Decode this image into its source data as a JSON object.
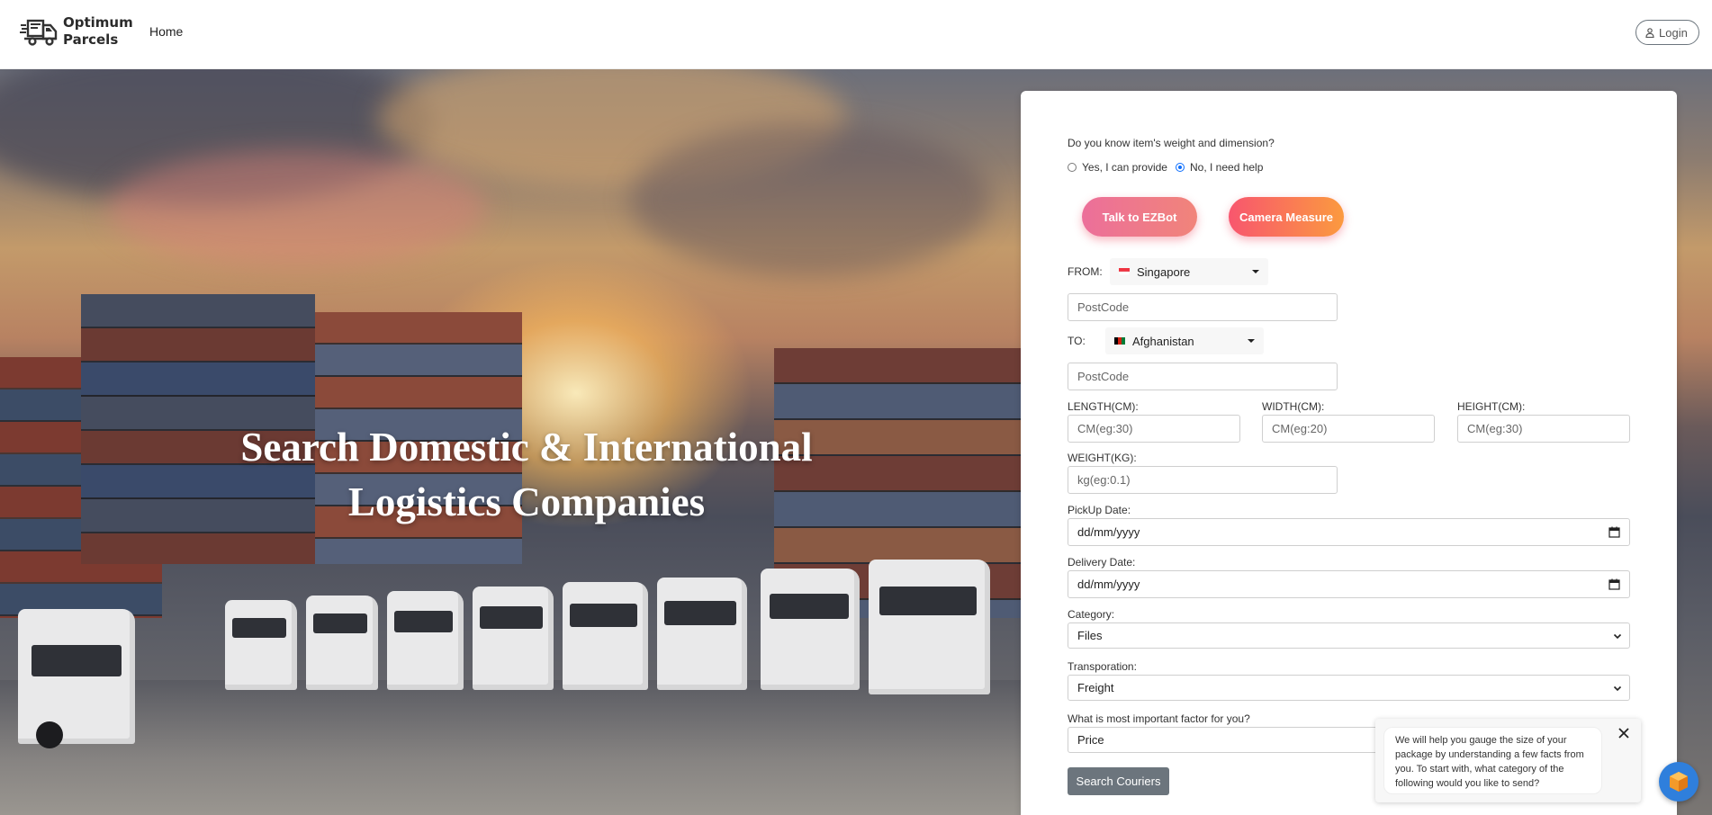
{
  "header": {
    "brand_line1": "Optimum",
    "brand_line2": "Parcels",
    "nav_home": "Home",
    "login_label": "Login"
  },
  "hero": {
    "title_line1": "Search Domestic & International",
    "title_line2": "Logistics Companies"
  },
  "form": {
    "question": "Do you know item's weight and dimension?",
    "radio_yes": "Yes, I can provide",
    "radio_no": "No, I need help",
    "radio_selected": "no",
    "ezbot_label": "Talk to EZBot",
    "camera_label": "Camera Measure",
    "from_label": "FROM:",
    "from_country": "Singapore",
    "from_postcode_placeholder": "PostCode",
    "to_label": "TO:",
    "to_country": "Afghanistan",
    "to_postcode_placeholder": "PostCode",
    "length_label": "LENGTH(CM):",
    "length_placeholder": "CM(eg:30)",
    "width_label": "WIDTH(CM):",
    "width_placeholder": "CM(eg:20)",
    "height_label": "HEIGHT(CM):",
    "height_placeholder": "CM(eg:30)",
    "weight_label": "WEIGHT(KG):",
    "weight_placeholder": "kg(eg:0.1)",
    "pickup_label": "PickUp Date:",
    "pickup_value": "dd/mm/yyyy",
    "delivery_label": "Delivery Date:",
    "delivery_value": "dd/mm/yyyy",
    "category_label": "Category:",
    "category_value": "Files",
    "transport_label": "Transporation:",
    "transport_value": "Freight",
    "factor_label": "What is most important factor for you?",
    "factor_value": "Price",
    "search_label": "Search Couriers"
  },
  "chat": {
    "message": "We will help you gauge the size of your package by understanding a few facts from you. To start with, what category of the following would you like to send?"
  },
  "colors": {
    "accent_blue": "#0d6efd",
    "ezbot_gradient": [
      "#ec6f9a",
      "#f1847a"
    ],
    "camera_gradient": [
      "#f8566e",
      "#fb9a3f"
    ],
    "search_button": "#6c757d",
    "chat_fab": "#2f7fdc"
  },
  "icons": [
    "truck-logo-icon",
    "user-icon",
    "singapore-flag-icon",
    "afghanistan-flag-icon",
    "calendar-icon",
    "chevron-down-icon",
    "close-icon",
    "chat-bot-icon"
  ]
}
